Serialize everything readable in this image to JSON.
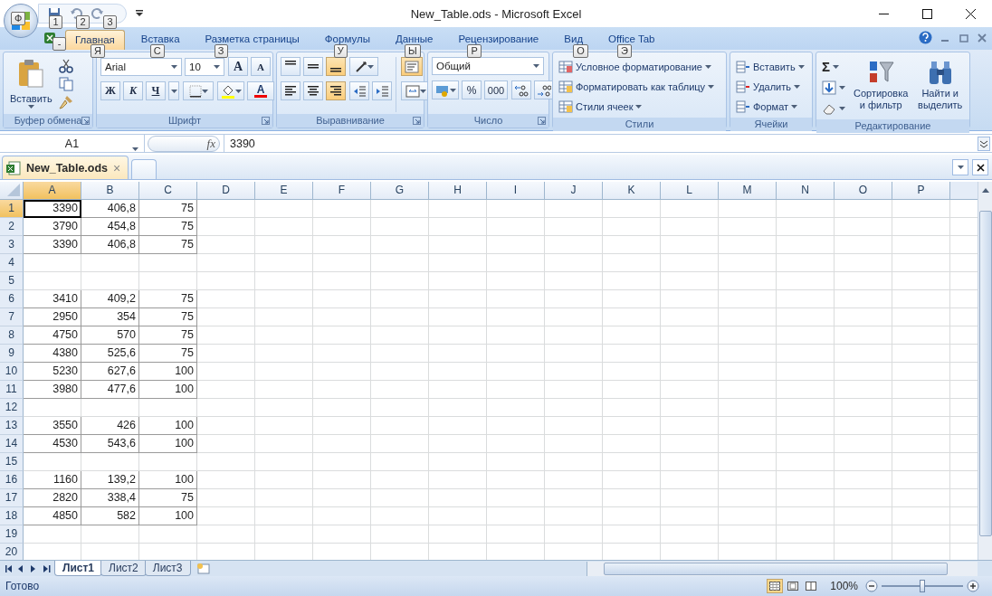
{
  "window": {
    "title": "New_Table.ods - Microsoft Excel",
    "office_button_keytip": "Ф",
    "quick_access_keytips": [
      "1",
      "2",
      "3"
    ],
    "file_icon_keytip": "-"
  },
  "tabs": [
    {
      "label": "Главная",
      "selected": true,
      "keytip": "Я"
    },
    {
      "label": "Вставка",
      "selected": false,
      "keytip": "С"
    },
    {
      "label": "Разметка страницы",
      "selected": false,
      "keytip": "З"
    },
    {
      "label": "Формулы",
      "selected": false,
      "keytip": "У"
    },
    {
      "label": "Данные",
      "selected": false,
      "keytip": "Ы"
    },
    {
      "label": "Рецензирование",
      "selected": false,
      "keytip": "Р"
    },
    {
      "label": "Вид",
      "selected": false,
      "keytip": "О"
    },
    {
      "label": "Office Tab",
      "selected": false,
      "keytip": "Э"
    }
  ],
  "ribbon": {
    "clipboard": {
      "title": "Буфер обмена",
      "paste": "Вставить"
    },
    "font": {
      "title": "Шрифт",
      "font_name": "Arial",
      "font_size": "10",
      "grow": "A",
      "shrink": "A",
      "bold": "Ж",
      "italic": "К",
      "underline": "Ч",
      "font_color": "A"
    },
    "alignment": {
      "title": "Выравнивание",
      "vertical": [
        {
          "kind": "top",
          "active": false
        },
        {
          "kind": "middle",
          "active": false
        },
        {
          "kind": "bottom",
          "active": true
        }
      ],
      "horizontal": [
        {
          "kind": "left",
          "active": false
        },
        {
          "kind": "center",
          "active": false
        },
        {
          "kind": "right",
          "active": true
        }
      ],
      "wrap_active": true
    },
    "number": {
      "title": "Число",
      "format": "Общий",
      "percent": "%",
      "thousands": "000"
    },
    "styles": {
      "title": "Стили",
      "items": [
        "Условное форматирование",
        "Форматировать как таблицу",
        "Стили ячеек"
      ]
    },
    "cells": {
      "title": "Ячейки",
      "items": [
        "Вставить",
        "Удалить",
        "Формат"
      ]
    },
    "editing": {
      "title": "Редактирование",
      "sum": "Σ",
      "sort": "Сортировка и фильтр",
      "find": "Найти и выделить"
    }
  },
  "formula_bar": {
    "name_box": "A1",
    "fx": "fx",
    "value": "3390"
  },
  "document_tab": {
    "label": "New_Table.ods",
    "close": "×"
  },
  "columns": [
    {
      "label": "A",
      "selected": true
    },
    {
      "label": "B",
      "selected": false
    },
    {
      "label": "C",
      "selected": false
    },
    {
      "label": "D",
      "selected": false
    },
    {
      "label": "E",
      "selected": false
    },
    {
      "label": "F",
      "selected": false
    },
    {
      "label": "G",
      "selected": false
    },
    {
      "label": "H",
      "selected": false
    },
    {
      "label": "I",
      "selected": false
    },
    {
      "label": "J",
      "selected": false
    },
    {
      "label": "K",
      "selected": false
    },
    {
      "label": "L",
      "selected": false
    },
    {
      "label": "M",
      "selected": false
    },
    {
      "label": "N",
      "selected": false
    },
    {
      "label": "O",
      "selected": false
    },
    {
      "label": "P",
      "selected": false
    }
  ],
  "rows": [
    {
      "label": "1",
      "selected": true,
      "cells": [
        "3390",
        "406,8",
        "75"
      ]
    },
    {
      "label": "2",
      "selected": false,
      "cells": [
        "3790",
        "454,8",
        "75"
      ]
    },
    {
      "label": "3",
      "selected": false,
      "cells": [
        "3390",
        "406,8",
        "75"
      ]
    },
    {
      "label": "4",
      "selected": false,
      "cells": []
    },
    {
      "label": "5",
      "selected": false,
      "cells": []
    },
    {
      "label": "6",
      "selected": false,
      "cells": [
        "3410",
        "409,2",
        "75"
      ]
    },
    {
      "label": "7",
      "selected": false,
      "cells": [
        "2950",
        "354",
        "75"
      ]
    },
    {
      "label": "8",
      "selected": false,
      "cells": [
        "4750",
        "570",
        "75"
      ]
    },
    {
      "label": "9",
      "selected": false,
      "cells": [
        "4380",
        "525,6",
        "75"
      ]
    },
    {
      "label": "10",
      "selected": false,
      "cells": [
        "5230",
        "627,6",
        "100"
      ]
    },
    {
      "label": "11",
      "selected": false,
      "cells": [
        "3980",
        "477,6",
        "100"
      ]
    },
    {
      "label": "12",
      "selected": false,
      "cells": []
    },
    {
      "label": "13",
      "selected": false,
      "cells": [
        "3550",
        "426",
        "100"
      ]
    },
    {
      "label": "14",
      "selected": false,
      "cells": [
        "4530",
        "543,6",
        "100"
      ]
    },
    {
      "label": "15",
      "selected": false,
      "cells": []
    },
    {
      "label": "16",
      "selected": false,
      "cells": [
        "1160",
        "139,2",
        "100"
      ]
    },
    {
      "label": "17",
      "selected": false,
      "cells": [
        "2820",
        "338,4",
        "75"
      ]
    },
    {
      "label": "18",
      "selected": false,
      "cells": [
        "4850",
        "582",
        "100"
      ]
    },
    {
      "label": "19",
      "selected": false,
      "cells": []
    },
    {
      "label": "20",
      "selected": false,
      "cells": []
    }
  ],
  "sheet_tabs": [
    {
      "label": "Лист1",
      "selected": true
    },
    {
      "label": "Лист2",
      "selected": false
    },
    {
      "label": "Лист3",
      "selected": false
    }
  ],
  "status_bar": {
    "status": "Готово",
    "zoom": "100%",
    "zoom_slider": {
      "level": 0.5
    },
    "views": [
      {
        "kind": "normal",
        "selected": true
      },
      {
        "kind": "layout",
        "selected": false
      },
      {
        "kind": "pagebreak",
        "selected": false
      }
    ]
  }
}
